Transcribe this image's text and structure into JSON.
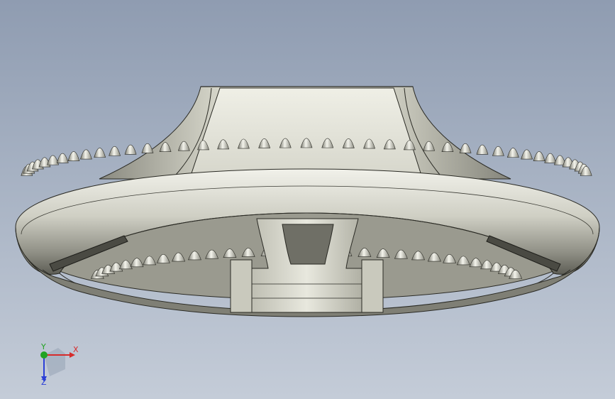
{
  "viewport": {
    "background_top": "#8f9cb1",
    "background_bottom": "#c4ccd8"
  },
  "model": {
    "shade_light": "#e6e6dc",
    "shade_mid": "#b8b8ab",
    "shade_dark": "#6e6e64",
    "edge_color": "#2a2a24"
  },
  "triad": {
    "x_label": "X",
    "y_label": "Y",
    "z_label": "Z",
    "x_color": "#d62b2b",
    "y_color": "#21a321",
    "z_color": "#2b3fd6"
  }
}
